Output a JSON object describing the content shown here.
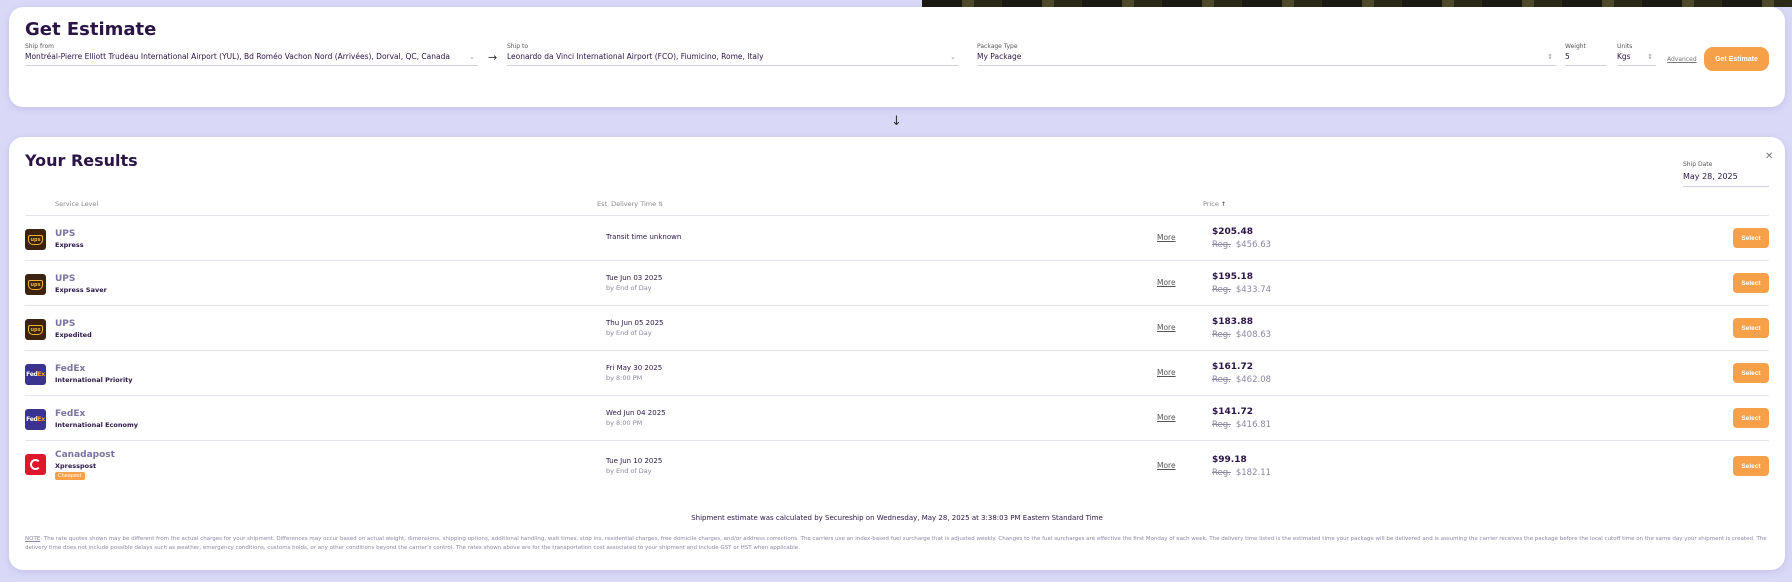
{
  "estimate": {
    "title": "Get Estimate",
    "ship_from": {
      "label": "Ship from",
      "value": "Montréal-Pierre Elliott Trudeau International Airport (YUL), Bd Roméo Vachon Nord (Arrivées), Dorval, QC, Canada"
    },
    "ship_to": {
      "label": "Ship to",
      "value": "Leonardo da Vinci International Airport (FCO), Fiumicino, Rome, Italy"
    },
    "package_type": {
      "label": "Package Type",
      "value": "My Package"
    },
    "weight": {
      "label": "Weight",
      "value": "5"
    },
    "units": {
      "label": "Units",
      "value": "Kgs"
    },
    "advanced_label": "Advanced",
    "button_label": "Get Estimate"
  },
  "results": {
    "title": "Your Results",
    "ship_date": {
      "label": "Ship Date",
      "value": "May 28, 2025"
    },
    "columns": {
      "service": "Service Level",
      "delivery": "Est. Delivery Time",
      "price": "Price"
    },
    "more_label": "More",
    "select_label": "Select",
    "reg_label": "Reg.",
    "rows": [
      {
        "carrier": "UPS",
        "service": "Express",
        "delivery": "Transit time unknown",
        "delivery_sub": "",
        "price": "$205.48",
        "reg": "$456.63",
        "badge": ""
      },
      {
        "carrier": "UPS",
        "service": "Express Saver",
        "delivery": "Tue Jun 03 2025",
        "delivery_sub": "by End of Day",
        "price": "$195.18",
        "reg": "$433.74",
        "badge": ""
      },
      {
        "carrier": "UPS",
        "service": "Expedited",
        "delivery": "Thu Jun 05 2025",
        "delivery_sub": "by End of Day",
        "price": "$183.88",
        "reg": "$408.63",
        "badge": ""
      },
      {
        "carrier": "FedEx",
        "service": "International Priority",
        "delivery": "Fri May 30 2025",
        "delivery_sub": "by 8:00 PM",
        "price": "$161.72",
        "reg": "$462.08",
        "badge": ""
      },
      {
        "carrier": "FedEx",
        "service": "International Economy",
        "delivery": "Wed Jun 04 2025",
        "delivery_sub": "by 8:00 PM",
        "price": "$141.72",
        "reg": "$416.81",
        "badge": ""
      },
      {
        "carrier": "Canadapost",
        "service": "Xpresspost",
        "delivery": "Tue Jun 10 2025",
        "delivery_sub": "by End of Day",
        "price": "$99.18",
        "reg": "$182.11",
        "badge": "Cheapest"
      }
    ],
    "calc_note": "Shipment estimate was calculated by Secureship on Wednesday, May 28, 2025 at 3:38:03 PM Eastern Standard Time",
    "note_label": "NOTE",
    "note_text": ": The rate quotes shown may be different from the actual charges for your shipment. Differences may occur based on actual weight, dimensions, shipping options, additional handling, wait times, stop ins, residential charges, free domicile charges, and/or address corrections. The carriers use an index-based fuel surcharge that is adjusted weekly. Changes to the fuel surcharges are effective the first Monday of each week. The delivery time listed is the estimated time your package will be delivered and is assuming the carrier receives the package before the local cutoff time on the same day your shipment is created. The delivery time does not include possible delays such as weather, emergency conditions, customs holds, or any other conditions beyond the carrier's control. The rates shown above are for the transportation cost associated to your shipment and include GST or HST when applicable."
  }
}
